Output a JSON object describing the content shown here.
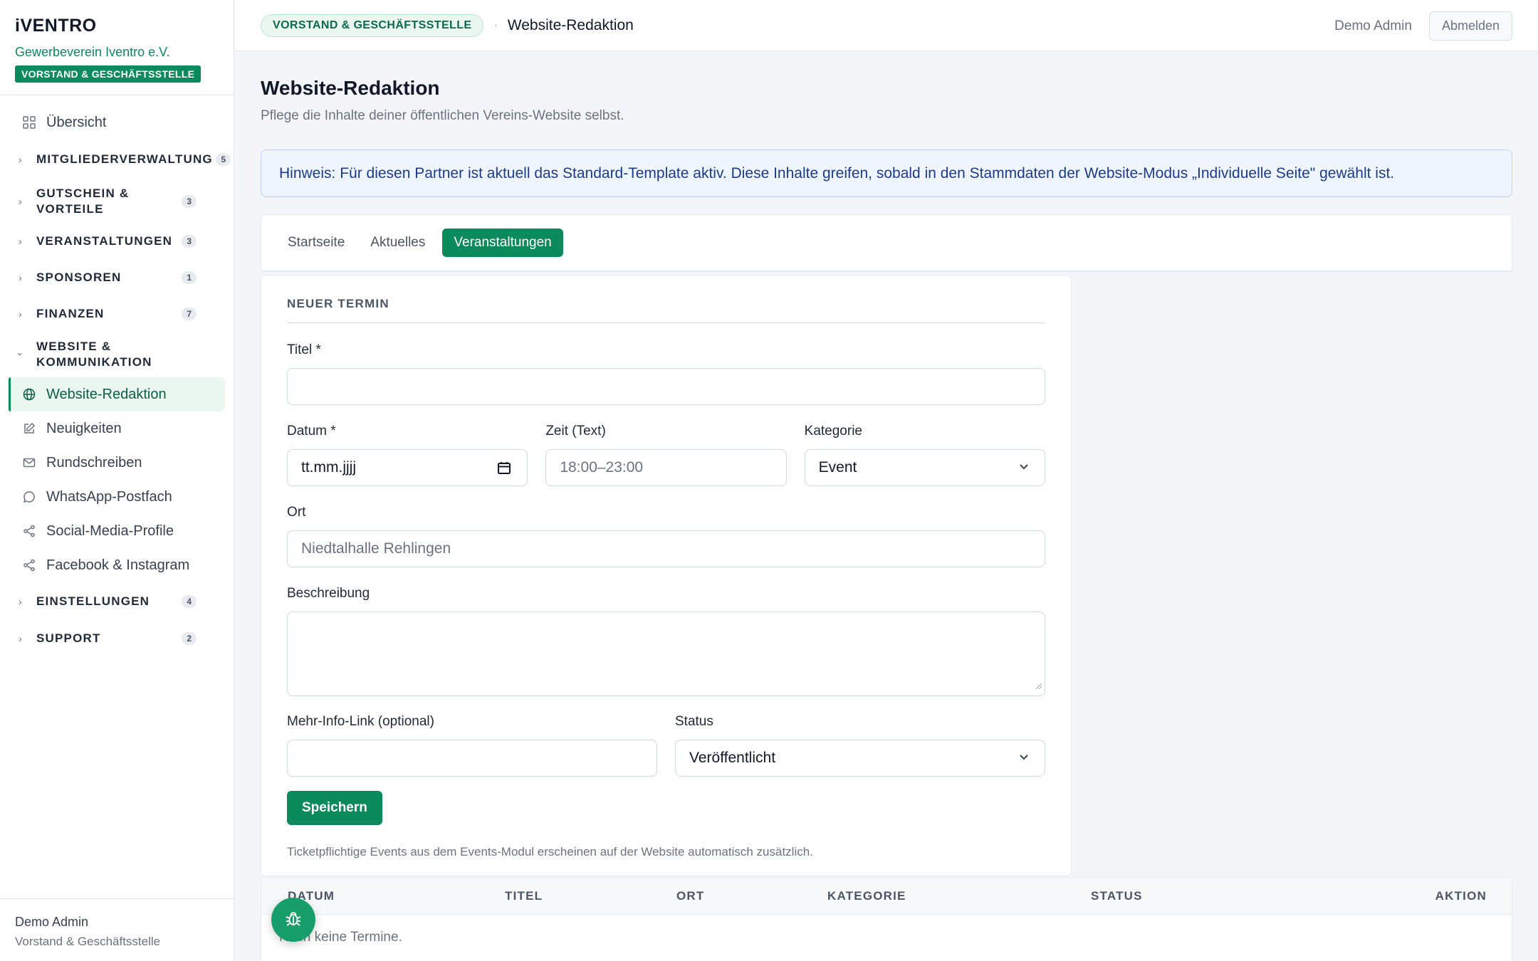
{
  "brand": {
    "logo": "iVENTRO",
    "org_name": "Gewerbeverein Iventro e.V.",
    "org_badge": "VORSTAND & GESCHÄFTSSTELLE"
  },
  "sidebar": {
    "overview": "Übersicht",
    "groups": {
      "mitglieder": {
        "label": "MITGLIEDERVERWALTUNG",
        "count": "5"
      },
      "gutschein": {
        "label": "GUTSCHEIN & VORTEILE",
        "count": "3"
      },
      "veranstaltungen": {
        "label": "VERANSTALTUNGEN",
        "count": "3"
      },
      "sponsoren": {
        "label": "SPONSOREN",
        "count": "1"
      },
      "finanzen": {
        "label": "FINANZEN",
        "count": "7"
      },
      "website": {
        "label": "WEBSITE & KOMMUNIKATION"
      },
      "einstellungen": {
        "label": "EINSTELLUNGEN",
        "count": "4"
      },
      "support": {
        "label": "SUPPORT",
        "count": "2"
      }
    },
    "sub_items": {
      "website_redaktion": "Website-Redaktion",
      "neuigkeiten": "Neuigkeiten",
      "rundschreiben": "Rundschreiben",
      "whatsapp": "WhatsApp-Postfach",
      "social": "Social-Media-Profile",
      "facebook": "Facebook & Instagram"
    },
    "footer": {
      "name": "Demo Admin",
      "role": "Vorstand & Geschäftsstelle"
    }
  },
  "topbar": {
    "badge": "VORSTAND & GESCHÄFTSSTELLE",
    "separator": "·",
    "page": "Website-Redaktion",
    "user": "Demo Admin",
    "logout": "Abmelden"
  },
  "main": {
    "title": "Website-Redaktion",
    "subtitle": "Pflege die Inhalte deiner öffentlichen Vereins-Website selbst.",
    "notice": "Hinweis: Für diesen Partner ist aktuell das Standard-Template aktiv. Diese Inhalte greifen, sobald in den Stammdaten der Website-Modus „Individuelle Seite\" gewählt ist.",
    "tabs": [
      "Startseite",
      "Aktuelles",
      "Veranstaltungen"
    ]
  },
  "form": {
    "section_title": "NEUER TERMIN",
    "titel_label": "Titel *",
    "datum_label": "Datum *",
    "datum_value": "tt.mm.jjjj",
    "zeit_label": "Zeit (Text)",
    "zeit_placeholder": "18:00–23:00",
    "kategorie_label": "Kategorie",
    "kategorie_value": "Event",
    "ort_label": "Ort",
    "ort_placeholder": "Niedtalhalle Rehlingen",
    "beschreibung_label": "Beschreibung",
    "link_label": "Mehr-Info-Link (optional)",
    "status_label": "Status",
    "status_value": "Veröffentlicht",
    "save": "Speichern",
    "helper": "Ticketpflichtige Events aus dem Events-Modul erscheinen auf der Website automatisch zusätzlich."
  },
  "table": {
    "headers": [
      "DATUM",
      "TITEL",
      "ORT",
      "KATEGORIE",
      "STATUS",
      "AKTION"
    ],
    "empty": "Noch keine Termine."
  },
  "colors": {
    "accent": "#0b8a5b",
    "notice_bg": "#eef5fe",
    "notice_text": "#1e3a8a"
  },
  "icons": [
    "grid-icon",
    "chevron-right-icon",
    "chevron-down-icon",
    "globe-icon",
    "edit-icon",
    "mail-icon",
    "chat-icon",
    "share-icon",
    "calendar-icon",
    "bug-icon"
  ]
}
